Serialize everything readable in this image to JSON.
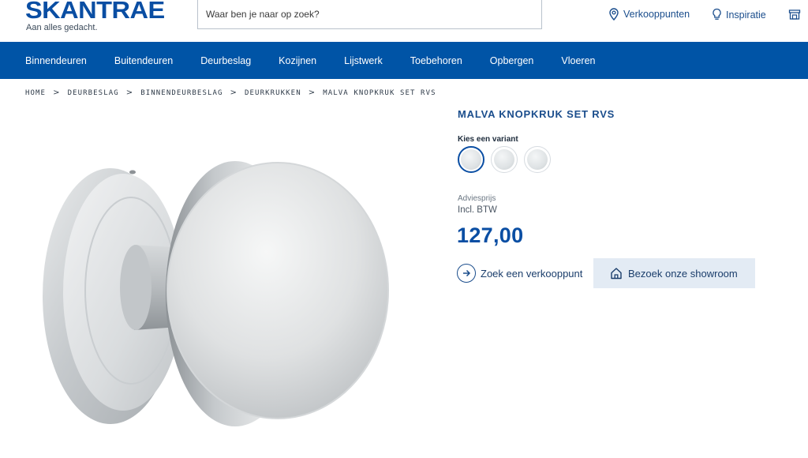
{
  "brand": {
    "name": "SKANTRAE",
    "tagline": "Aan alles gedacht."
  },
  "search": {
    "placeholder": "Waar ben je naar op zoek?"
  },
  "header_links": [
    {
      "label": "Verkooppunten",
      "icon": "location-pin-icon"
    },
    {
      "label": "Inspiratie",
      "icon": "lightbulb-icon"
    },
    {
      "label": "",
      "icon": "store-icon"
    }
  ],
  "nav": [
    "Binnendeuren",
    "Buitendeuren",
    "Deurbeslag",
    "Kozijnen",
    "Lijstwerk",
    "Toebehoren",
    "Opbergen",
    "Vloeren"
  ],
  "breadcrumb": [
    "HOME",
    "DEURBESLAG",
    "BINNENDEURBESLAG",
    "DEURKRUKKEN",
    "MALVA KNOPKRUK SET RVS"
  ],
  "product": {
    "title": "MALVA KNOPKRUK SET RVS",
    "variant_label": "Kies een variant",
    "variants_count": 3,
    "selected_variant": 1,
    "advies_label": "Adviesprijs",
    "btw_label": "Incl. BTW",
    "price": "127,00",
    "dealer_button": "Zoek een verkooppunt",
    "showroom_button": "Bezoek onze showroom"
  },
  "colors": {
    "brand": "#0a4ea3",
    "nav_bg": "#0054a6",
    "showroom_bg": "#e3ebf4"
  }
}
